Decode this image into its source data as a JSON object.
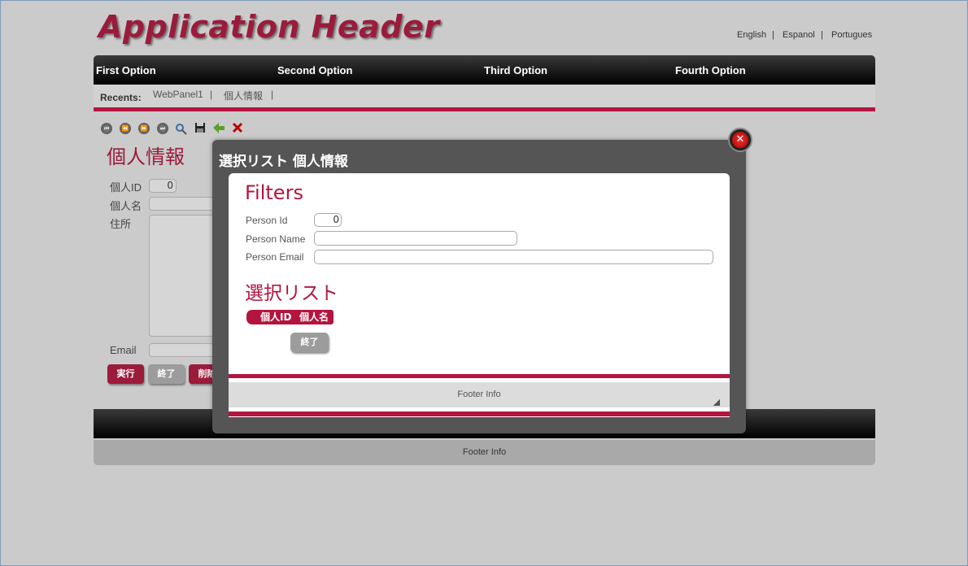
{
  "header": {
    "title": "Application Header",
    "languages": [
      "English",
      "Espanol",
      "Portugues"
    ],
    "lang_sep": "|"
  },
  "nav": {
    "items": [
      "First Option",
      "Second Option",
      "Third Option",
      "Fourth Option"
    ]
  },
  "recents": {
    "label": "Recents:",
    "items": [
      "WebPanel1",
      "個人情報"
    ],
    "sep": "|"
  },
  "toolbar": {
    "icons": [
      "first-icon",
      "previous-icon",
      "next-icon",
      "last-icon",
      "search-icon",
      "save-icon",
      "back-arrow-icon",
      "delete-icon"
    ]
  },
  "form": {
    "title": "個人情報",
    "id_label": "個人ID",
    "id_value": "0",
    "name_label": "個人名",
    "address_label": "住所",
    "email_label": "Email",
    "buttons": {
      "execute": "実行",
      "close": "終了",
      "delete": "削除"
    }
  },
  "page_footer": "Footer Info",
  "modal": {
    "title": "選択リスト 個人情報",
    "filters_heading": "Filters",
    "person_id_label": "Person Id",
    "person_id_value": "0",
    "person_name_label": "Person Name",
    "person_email_label": "Person Email",
    "list_heading": "選択リスト",
    "grid_columns": [
      "個人ID",
      "個人名"
    ],
    "close_button": "終了",
    "footer": "Footer Info"
  },
  "colors": {
    "accent": "#b3153f",
    "title": "#9b1b3b",
    "nav_bg": "#000000",
    "modal_bg": "#555555"
  }
}
